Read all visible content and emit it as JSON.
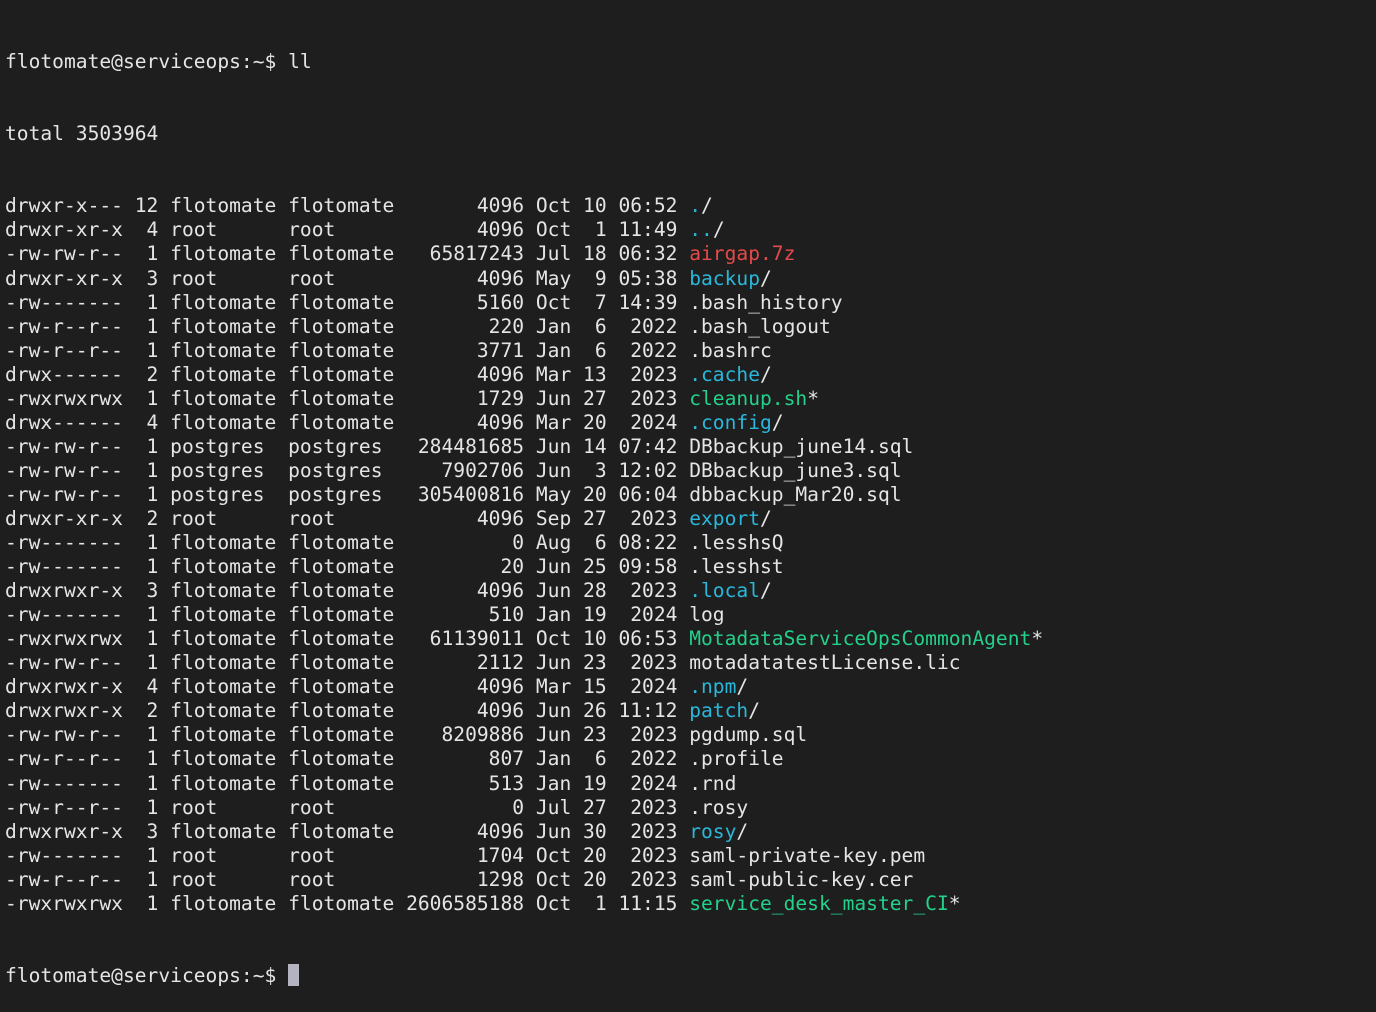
{
  "terminal": {
    "prompt": "flotomate@serviceops:~$ ",
    "command": "ll",
    "total_line": "total 3503964",
    "colors": {
      "background": "#1e1e1e",
      "text": "#e5e5e5",
      "directory": "#29b8db",
      "executable": "#23d18b",
      "archive": "#f14c4c"
    },
    "entries": [
      {
        "perms": "drwxr-x---",
        "links": "12",
        "owner": "flotomate",
        "group": "flotomate",
        "size": "4096",
        "month": "Oct",
        "day": "10",
        "time": "06:52",
        "name": ".",
        "suffix": "/",
        "kind": "dir"
      },
      {
        "perms": "drwxr-xr-x",
        "links": "4",
        "owner": "root",
        "group": "root",
        "size": "4096",
        "month": "Oct",
        "day": "1",
        "time": "11:49",
        "name": "..",
        "suffix": "/",
        "kind": "dir"
      },
      {
        "perms": "-rw-rw-r--",
        "links": "1",
        "owner": "flotomate",
        "group": "flotomate",
        "size": "65817243",
        "month": "Jul",
        "day": "18",
        "time": "06:32",
        "name": "airgap.7z",
        "suffix": "",
        "kind": "archive"
      },
      {
        "perms": "drwxr-xr-x",
        "links": "3",
        "owner": "root",
        "group": "root",
        "size": "4096",
        "month": "May",
        "day": "9",
        "time": "05:38",
        "name": "backup",
        "suffix": "/",
        "kind": "dir"
      },
      {
        "perms": "-rw-------",
        "links": "1",
        "owner": "flotomate",
        "group": "flotomate",
        "size": "5160",
        "month": "Oct",
        "day": "7",
        "time": "14:39",
        "name": ".bash_history",
        "suffix": "",
        "kind": "plain"
      },
      {
        "perms": "-rw-r--r--",
        "links": "1",
        "owner": "flotomate",
        "group": "flotomate",
        "size": "220",
        "month": "Jan",
        "day": "6",
        "time": "2022",
        "name": ".bash_logout",
        "suffix": "",
        "kind": "plain"
      },
      {
        "perms": "-rw-r--r--",
        "links": "1",
        "owner": "flotomate",
        "group": "flotomate",
        "size": "3771",
        "month": "Jan",
        "day": "6",
        "time": "2022",
        "name": ".bashrc",
        "suffix": "",
        "kind": "plain"
      },
      {
        "perms": "drwx------",
        "links": "2",
        "owner": "flotomate",
        "group": "flotomate",
        "size": "4096",
        "month": "Mar",
        "day": "13",
        "time": "2023",
        "name": ".cache",
        "suffix": "/",
        "kind": "dir"
      },
      {
        "perms": "-rwxrwxrwx",
        "links": "1",
        "owner": "flotomate",
        "group": "flotomate",
        "size": "1729",
        "month": "Jun",
        "day": "27",
        "time": "2023",
        "name": "cleanup.sh",
        "suffix": "*",
        "kind": "exec"
      },
      {
        "perms": "drwx------",
        "links": "4",
        "owner": "flotomate",
        "group": "flotomate",
        "size": "4096",
        "month": "Mar",
        "day": "20",
        "time": "2024",
        "name": ".config",
        "suffix": "/",
        "kind": "dir"
      },
      {
        "perms": "-rw-rw-r--",
        "links": "1",
        "owner": "postgres",
        "group": "postgres",
        "size": "284481685",
        "month": "Jun",
        "day": "14",
        "time": "07:42",
        "name": "DBbackup_june14.sql",
        "suffix": "",
        "kind": "plain"
      },
      {
        "perms": "-rw-rw-r--",
        "links": "1",
        "owner": "postgres",
        "group": "postgres",
        "size": "7902706",
        "month": "Jun",
        "day": "3",
        "time": "12:02",
        "name": "DBbackup_june3.sql",
        "suffix": "",
        "kind": "plain"
      },
      {
        "perms": "-rw-rw-r--",
        "links": "1",
        "owner": "postgres",
        "group": "postgres",
        "size": "305400816",
        "month": "May",
        "day": "20",
        "time": "06:04",
        "name": "dbbackup_Mar20.sql",
        "suffix": "",
        "kind": "plain"
      },
      {
        "perms": "drwxr-xr-x",
        "links": "2",
        "owner": "root",
        "group": "root",
        "size": "4096",
        "month": "Sep",
        "day": "27",
        "time": "2023",
        "name": "export",
        "suffix": "/",
        "kind": "dir"
      },
      {
        "perms": "-rw-------",
        "links": "1",
        "owner": "flotomate",
        "group": "flotomate",
        "size": "0",
        "month": "Aug",
        "day": "6",
        "time": "08:22",
        "name": ".lesshsQ",
        "suffix": "",
        "kind": "plain"
      },
      {
        "perms": "-rw-------",
        "links": "1",
        "owner": "flotomate",
        "group": "flotomate",
        "size": "20",
        "month": "Jun",
        "day": "25",
        "time": "09:58",
        "name": ".lesshst",
        "suffix": "",
        "kind": "plain"
      },
      {
        "perms": "drwxrwxr-x",
        "links": "3",
        "owner": "flotomate",
        "group": "flotomate",
        "size": "4096",
        "month": "Jun",
        "day": "28",
        "time": "2023",
        "name": ".local",
        "suffix": "/",
        "kind": "dir"
      },
      {
        "perms": "-rw-------",
        "links": "1",
        "owner": "flotomate",
        "group": "flotomate",
        "size": "510",
        "month": "Jan",
        "day": "19",
        "time": "2024",
        "name": "log",
        "suffix": "",
        "kind": "plain"
      },
      {
        "perms": "-rwxrwxrwx",
        "links": "1",
        "owner": "flotomate",
        "group": "flotomate",
        "size": "61139011",
        "month": "Oct",
        "day": "10",
        "time": "06:53",
        "name": "MotadataServiceOpsCommonAgent",
        "suffix": "*",
        "kind": "exec"
      },
      {
        "perms": "-rw-rw-r--",
        "links": "1",
        "owner": "flotomate",
        "group": "flotomate",
        "size": "2112",
        "month": "Jun",
        "day": "23",
        "time": "2023",
        "name": "motadatatestLicense.lic",
        "suffix": "",
        "kind": "plain"
      },
      {
        "perms": "drwxrwxr-x",
        "links": "4",
        "owner": "flotomate",
        "group": "flotomate",
        "size": "4096",
        "month": "Mar",
        "day": "15",
        "time": "2024",
        "name": ".npm",
        "suffix": "/",
        "kind": "dir"
      },
      {
        "perms": "drwxrwxr-x",
        "links": "2",
        "owner": "flotomate",
        "group": "flotomate",
        "size": "4096",
        "month": "Jun",
        "day": "26",
        "time": "11:12",
        "name": "patch",
        "suffix": "/",
        "kind": "dir"
      },
      {
        "perms": "-rw-rw-r--",
        "links": "1",
        "owner": "flotomate",
        "group": "flotomate",
        "size": "8209886",
        "month": "Jun",
        "day": "23",
        "time": "2023",
        "name": "pgdump.sql",
        "suffix": "",
        "kind": "plain"
      },
      {
        "perms": "-rw-r--r--",
        "links": "1",
        "owner": "flotomate",
        "group": "flotomate",
        "size": "807",
        "month": "Jan",
        "day": "6",
        "time": "2022",
        "name": ".profile",
        "suffix": "",
        "kind": "plain"
      },
      {
        "perms": "-rw-------",
        "links": "1",
        "owner": "flotomate",
        "group": "flotomate",
        "size": "513",
        "month": "Jan",
        "day": "19",
        "time": "2024",
        "name": ".rnd",
        "suffix": "",
        "kind": "plain"
      },
      {
        "perms": "-rw-r--r--",
        "links": "1",
        "owner": "root",
        "group": "root",
        "size": "0",
        "month": "Jul",
        "day": "27",
        "time": "2023",
        "name": ".rosy",
        "suffix": "",
        "kind": "plain"
      },
      {
        "perms": "drwxrwxr-x",
        "links": "3",
        "owner": "flotomate",
        "group": "flotomate",
        "size": "4096",
        "month": "Jun",
        "day": "30",
        "time": "2023",
        "name": "rosy",
        "suffix": "/",
        "kind": "dir"
      },
      {
        "perms": "-rw-------",
        "links": "1",
        "owner": "root",
        "group": "root",
        "size": "1704",
        "month": "Oct",
        "day": "20",
        "time": "2023",
        "name": "saml-private-key.pem",
        "suffix": "",
        "kind": "plain"
      },
      {
        "perms": "-rw-r--r--",
        "links": "1",
        "owner": "root",
        "group": "root",
        "size": "1298",
        "month": "Oct",
        "day": "20",
        "time": "2023",
        "name": "saml-public-key.cer",
        "suffix": "",
        "kind": "plain"
      },
      {
        "perms": "-rwxrwxrwx",
        "links": "1",
        "owner": "flotomate",
        "group": "flotomate",
        "size": "2606585188",
        "month": "Oct",
        "day": "1",
        "time": "11:15",
        "name": "service_desk_master_CI",
        "suffix": "*",
        "kind": "exec"
      }
    ]
  }
}
